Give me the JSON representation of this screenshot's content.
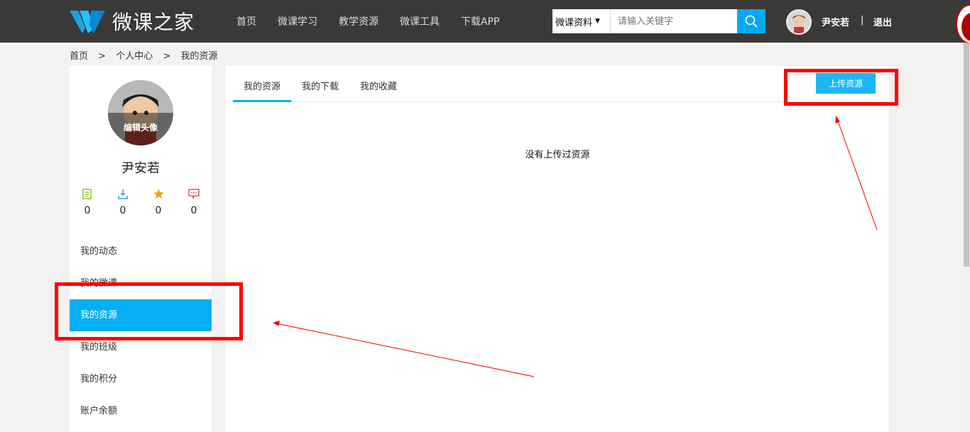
{
  "header": {
    "logo_text": "微课之家",
    "nav": [
      "首页",
      "微课学习",
      "教学资源",
      "微课工具",
      "下载APP"
    ],
    "search": {
      "category": "微课资料",
      "placeholder": "请输入关键字"
    },
    "user_name": "尹安若",
    "separator": "|",
    "logout": "退出"
  },
  "breadcrumb": [
    "首页",
    ">",
    "个人中心",
    ">",
    "我的资源"
  ],
  "sidebar": {
    "edit_avatar": "编辑头像",
    "name": "尹安若",
    "stats": [
      {
        "icon": "document-icon",
        "value": "0",
        "color": "#8dc21f"
      },
      {
        "icon": "download-icon",
        "value": "0",
        "color": "#3a9bd9"
      },
      {
        "icon": "star-icon",
        "value": "0",
        "color": "#f39c12"
      },
      {
        "icon": "message-icon",
        "value": "0",
        "color": "#e0353f"
      }
    ],
    "menu": [
      "我的动态",
      "我的微课",
      "我的资源",
      "我的班级",
      "我的积分",
      "账户余额"
    ],
    "active_menu": "我的资源"
  },
  "main": {
    "tabs": [
      "我的资源",
      "我的下载",
      "我的收藏"
    ],
    "active_tab": "我的资源",
    "upload_button": "上传资源",
    "empty_message": "没有上传过资源"
  },
  "colors": {
    "header_bg": "#3b3938",
    "accent": "#06aef5",
    "annotation": "#ff0000"
  }
}
